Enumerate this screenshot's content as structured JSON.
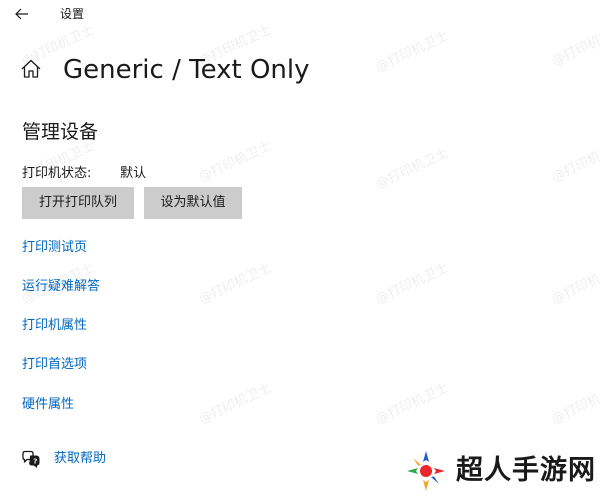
{
  "window": {
    "title": "设置",
    "back_icon": "back-arrow-icon"
  },
  "header": {
    "home_icon": "home-icon",
    "title": "Generic / Text Only"
  },
  "manage": {
    "section_title": "管理设备",
    "status_label": "打印机状态:",
    "status_value": "默认",
    "buttons": {
      "open_queue": "打开打印队列",
      "set_default": "设为默认值"
    }
  },
  "links": [
    {
      "label": "打印测试页"
    },
    {
      "label": "运行疑难解答"
    },
    {
      "label": "打印机属性"
    },
    {
      "label": "打印首选项"
    },
    {
      "label": "硬件属性"
    }
  ],
  "help": {
    "icon": "chat-help-icon",
    "label": "获取帮助"
  },
  "watermark": {
    "text": "@打印机卫士"
  },
  "brand": {
    "text": "超人手游网",
    "icon": "brand-logo-icon"
  },
  "colors": {
    "link": "#0067c0",
    "button_bg": "#cccccc",
    "text": "#1a1a1a",
    "background": "#ffffff"
  }
}
